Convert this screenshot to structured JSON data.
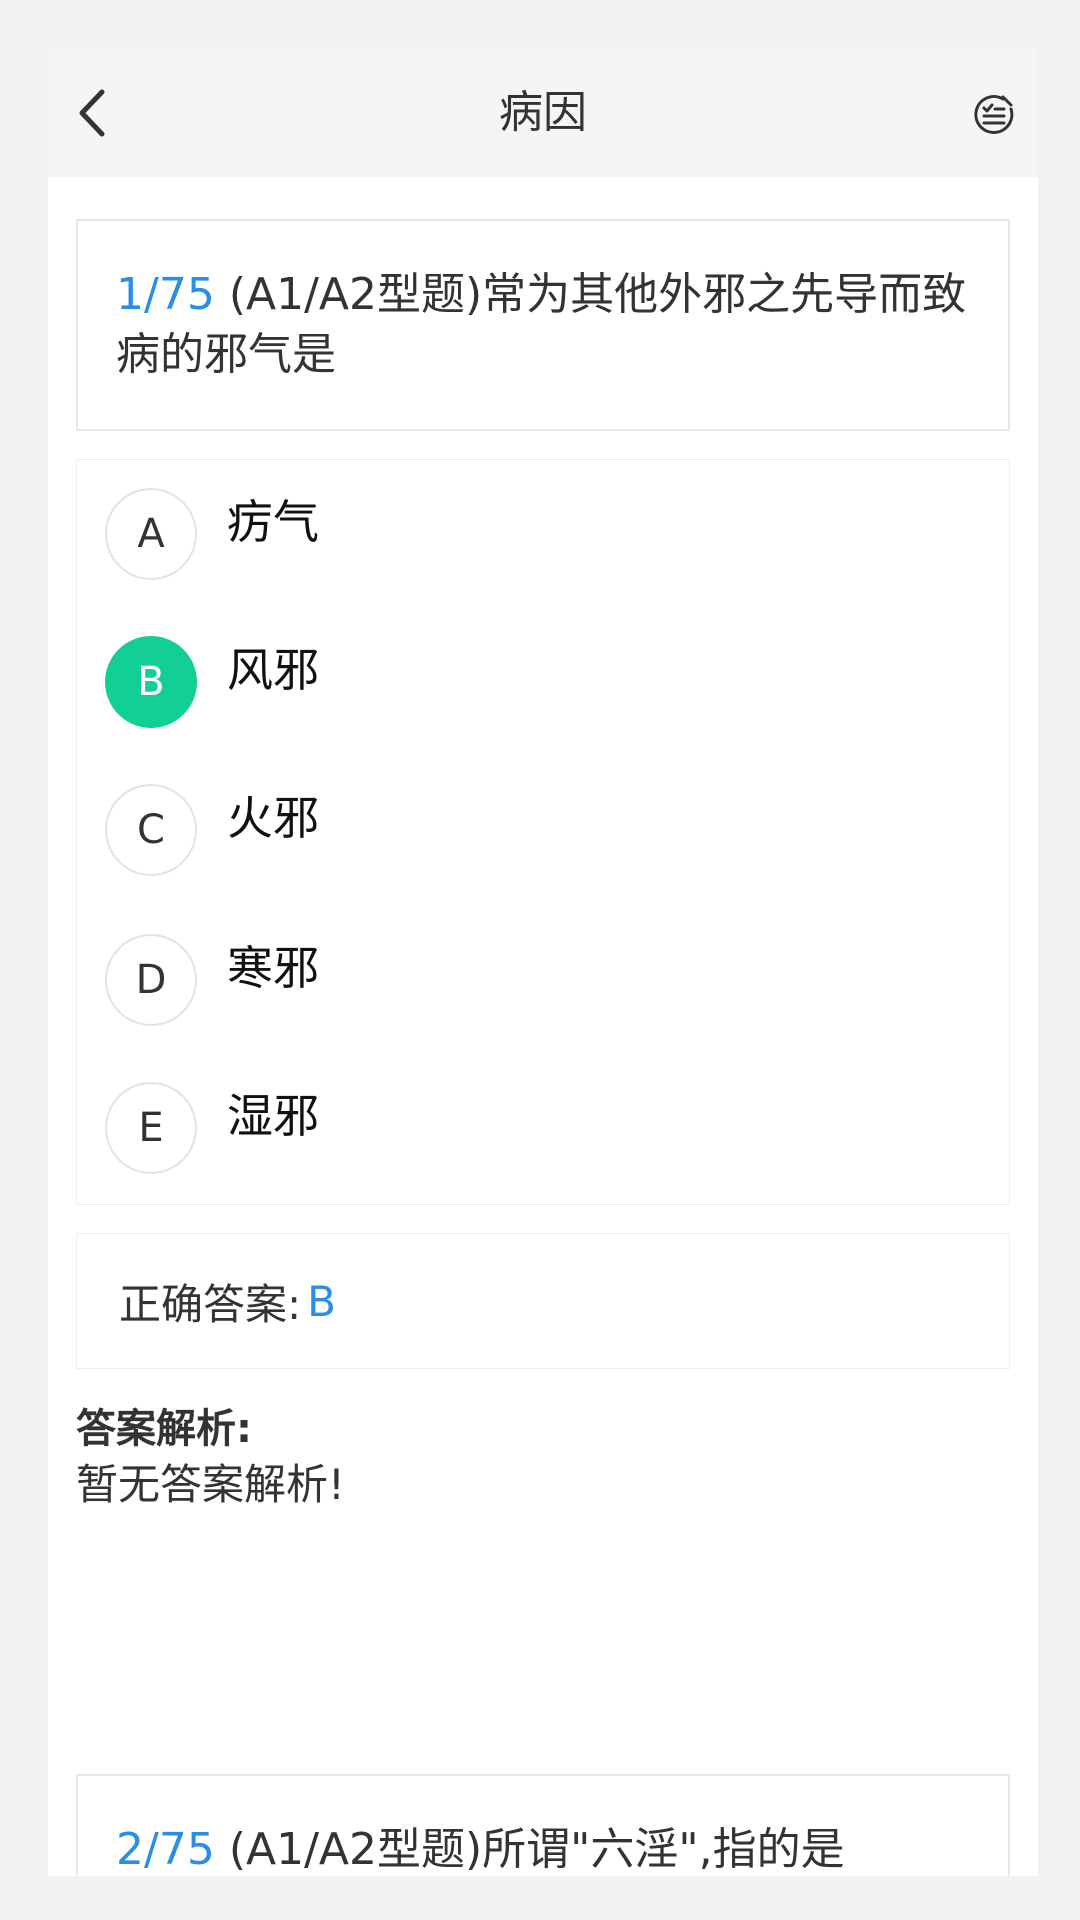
{
  "header": {
    "title": "病因",
    "back_icon": "chevron-left-icon",
    "menu_icon": "checklist-icon"
  },
  "questions": [
    {
      "number": "1/75",
      "text": "(A1/A2型题)常为其他外邪之先导而致病的邪气是",
      "options": [
        {
          "letter": "A",
          "text": "疠气"
        },
        {
          "letter": "B",
          "text": "风邪",
          "selected": true
        },
        {
          "letter": "C",
          "text": "火邪"
        },
        {
          "letter": "D",
          "text": "寒邪"
        },
        {
          "letter": "E",
          "text": "湿邪"
        }
      ],
      "answer": {
        "label": "正确答案:",
        "value": "B"
      },
      "analysis": {
        "title": "答案解析:",
        "text": "暂无答案解析!"
      }
    },
    {
      "number": "2/75",
      "text": "(A1/A2型题)所谓\"六淫\",指的是"
    }
  ],
  "colors": {
    "accent_blue": "#2a8ee6",
    "selected_green": "#12cf96"
  }
}
